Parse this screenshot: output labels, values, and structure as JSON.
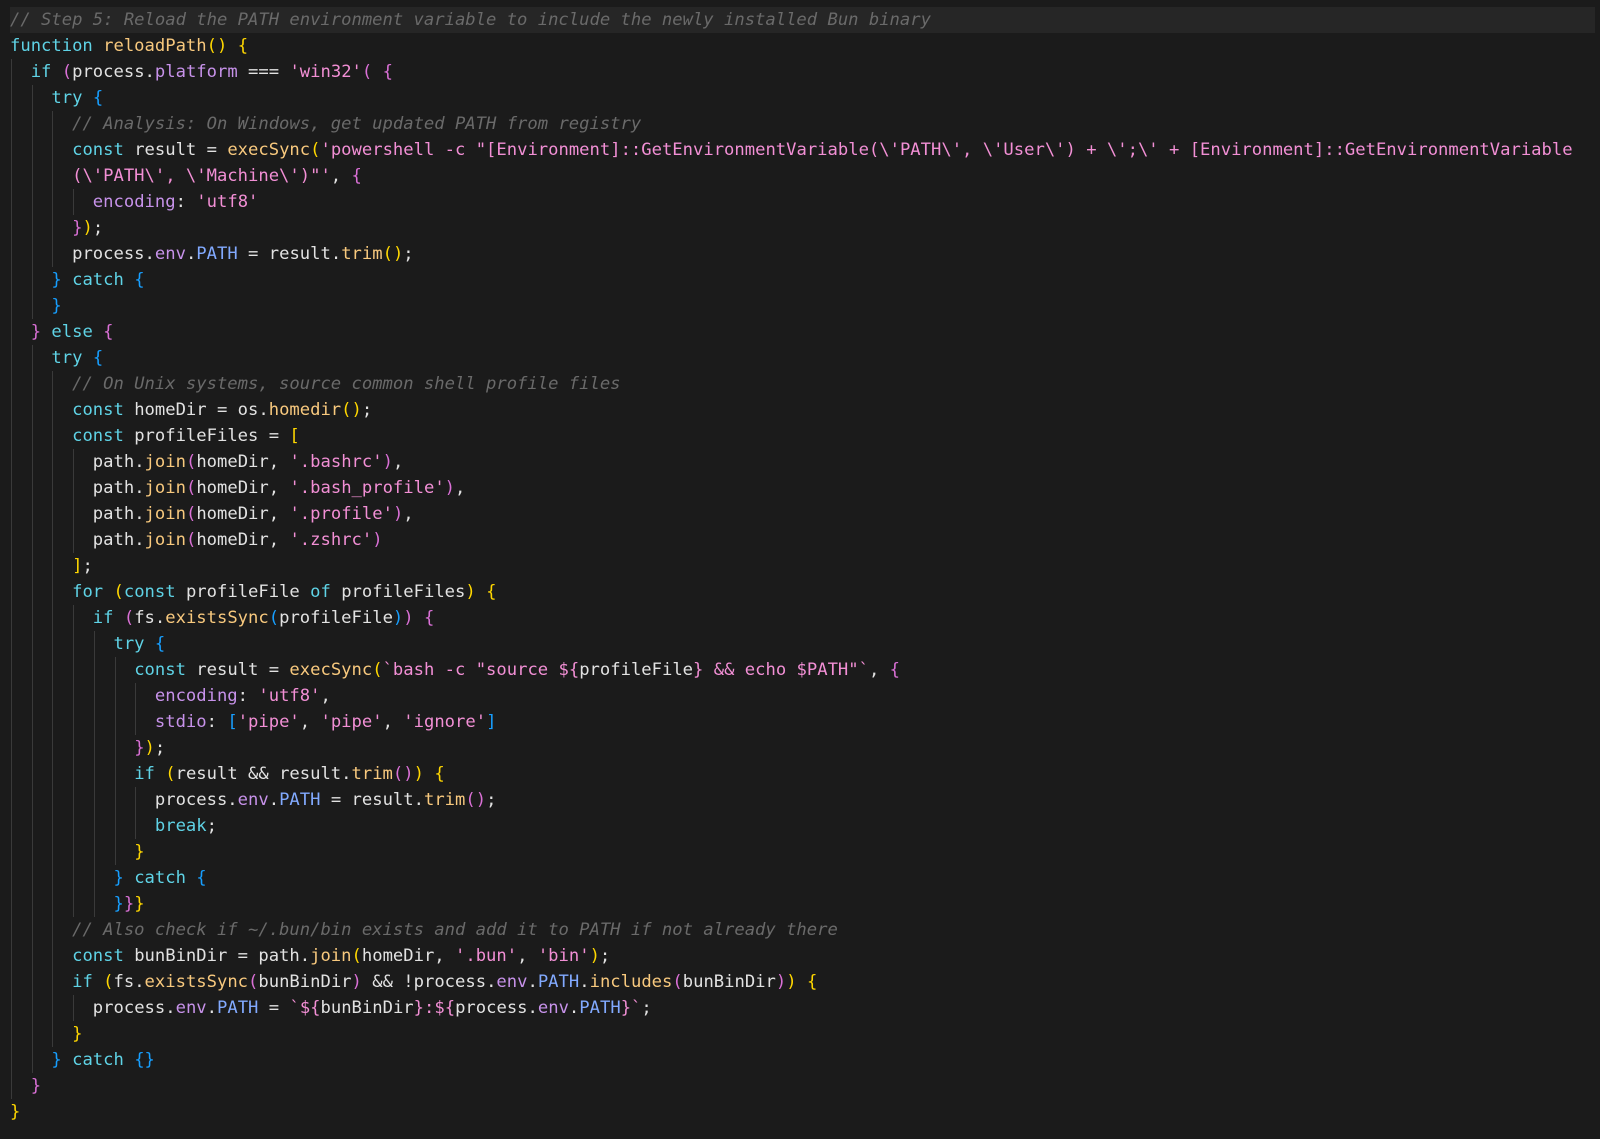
{
  "theme": {
    "background": "#1b1b1b",
    "highlight_line": "#262626",
    "indent_guide": "#3a3a3a",
    "colors": {
      "cm": "#6a6a6a",
      "kw": "#5fd3e6",
      "fn": "#f8c97e",
      "pl": "#e2e2e2",
      "pr": "#c792ea",
      "st": "#f28fd5",
      "cn": "#82aaff",
      "b1": "#ffd700",
      "b2": "#da70d6",
      "b3": "#179fff"
    }
  },
  "code": {
    "language": "javascript",
    "lines": [
      {
        "indent": 0,
        "hl": true,
        "tokens": [
          [
            "// Step 5: Reload the PATH environment variable to include the newly installed Bun binary",
            "cm"
          ]
        ]
      },
      {
        "indent": 0,
        "tokens": [
          [
            "function ",
            "kw"
          ],
          [
            "reloadPath",
            "fn"
          ],
          [
            "()",
            "b1"
          ],
          [
            " ",
            "pl"
          ],
          [
            "{",
            "b1"
          ]
        ]
      },
      {
        "indent": 1,
        "tokens": [
          [
            "if ",
            "kw"
          ],
          [
            "(",
            "b2"
          ],
          [
            "process.",
            "pl"
          ],
          [
            "platform",
            "pr"
          ],
          [
            " === ",
            "pl"
          ],
          [
            "'win32'",
            "st"
          ],
          [
            "(",
            "b2"
          ],
          [
            " ",
            "pl"
          ],
          [
            "{",
            "b2"
          ]
        ]
      },
      {
        "indent": 2,
        "tokens": [
          [
            "try ",
            "kw"
          ],
          [
            "{",
            "b3"
          ]
        ]
      },
      {
        "indent": 3,
        "tokens": [
          [
            "// Analysis: On Windows, get updated PATH from registry",
            "cm"
          ]
        ]
      },
      {
        "indent": 3,
        "tokens": [
          [
            "const ",
            "kw"
          ],
          [
            "result = ",
            "pl"
          ],
          [
            "execSync",
            "fn"
          ],
          [
            "(",
            "b1"
          ],
          [
            "'powershell -c \"[Environment]::GetEnvironmentVariable(\\'PATH\\', \\'User\\') + \\';\\' + [Environment]::GetEnvironmentVariable",
            "st"
          ]
        ]
      },
      {
        "indent": 3,
        "tokens": [
          [
            "(\\'PATH\\', \\'Machine\\')\"'",
            "st"
          ],
          [
            ", ",
            "pl"
          ],
          [
            "{",
            "b2"
          ]
        ]
      },
      {
        "indent": 4,
        "tokens": [
          [
            "encoding",
            "pr"
          ],
          [
            ": ",
            "pl"
          ],
          [
            "'utf8'",
            "st"
          ]
        ]
      },
      {
        "indent": 3,
        "tokens": [
          [
            "}",
            "b2"
          ],
          [
            ")",
            "b1"
          ],
          [
            ";",
            "pl"
          ]
        ]
      },
      {
        "indent": 3,
        "tokens": [
          [
            "process.",
            "pl"
          ],
          [
            "env",
            "pr"
          ],
          [
            ".",
            "pl"
          ],
          [
            "PATH",
            "cn"
          ],
          [
            " = result.",
            "pl"
          ],
          [
            "trim",
            "fn"
          ],
          [
            "()",
            "b1"
          ],
          [
            ";",
            "pl"
          ]
        ]
      },
      {
        "indent": 2,
        "tokens": [
          [
            "} ",
            "b3"
          ],
          [
            "catch ",
            "kw"
          ],
          [
            "{",
            "b3"
          ]
        ]
      },
      {
        "indent": 2,
        "tokens": [
          [
            "}",
            "b3"
          ]
        ]
      },
      {
        "indent": 1,
        "tokens": [
          [
            "} ",
            "b2"
          ],
          [
            "else ",
            "kw"
          ],
          [
            "{",
            "b2"
          ]
        ]
      },
      {
        "indent": 2,
        "tokens": [
          [
            "try ",
            "kw"
          ],
          [
            "{",
            "b3"
          ]
        ]
      },
      {
        "indent": 3,
        "tokens": [
          [
            "// On Unix systems, source common shell profile files",
            "cm"
          ]
        ]
      },
      {
        "indent": 3,
        "tokens": [
          [
            "const ",
            "kw"
          ],
          [
            "homeDir = os.",
            "pl"
          ],
          [
            "homedir",
            "fn"
          ],
          [
            "()",
            "b1"
          ],
          [
            ";",
            "pl"
          ]
        ]
      },
      {
        "indent": 3,
        "tokens": [
          [
            "const ",
            "kw"
          ],
          [
            "profileFiles = ",
            "pl"
          ],
          [
            "[",
            "b1"
          ]
        ]
      },
      {
        "indent": 4,
        "tokens": [
          [
            "path.",
            "pl"
          ],
          [
            "join",
            "fn"
          ],
          [
            "(",
            "b2"
          ],
          [
            "homeDir, ",
            "pl"
          ],
          [
            "'.bashrc'",
            "st"
          ],
          [
            ")",
            "b2"
          ],
          [
            ",",
            "pl"
          ]
        ]
      },
      {
        "indent": 4,
        "tokens": [
          [
            "path.",
            "pl"
          ],
          [
            "join",
            "fn"
          ],
          [
            "(",
            "b2"
          ],
          [
            "homeDir, ",
            "pl"
          ],
          [
            "'.bash_profile'",
            "st"
          ],
          [
            ")",
            "b2"
          ],
          [
            ",",
            "pl"
          ]
        ]
      },
      {
        "indent": 4,
        "tokens": [
          [
            "path.",
            "pl"
          ],
          [
            "join",
            "fn"
          ],
          [
            "(",
            "b2"
          ],
          [
            "homeDir, ",
            "pl"
          ],
          [
            "'.profile'",
            "st"
          ],
          [
            ")",
            "b2"
          ],
          [
            ",",
            "pl"
          ]
        ]
      },
      {
        "indent": 4,
        "tokens": [
          [
            "path.",
            "pl"
          ],
          [
            "join",
            "fn"
          ],
          [
            "(",
            "b2"
          ],
          [
            "homeDir, ",
            "pl"
          ],
          [
            "'.zshrc'",
            "st"
          ],
          [
            ")",
            "b2"
          ]
        ]
      },
      {
        "indent": 3,
        "tokens": [
          [
            "]",
            "b1"
          ],
          [
            ";",
            "pl"
          ]
        ]
      },
      {
        "indent": 3,
        "tokens": [
          [
            "for ",
            "kw"
          ],
          [
            "(",
            "b1"
          ],
          [
            "const ",
            "kw"
          ],
          [
            "profileFile ",
            "pl"
          ],
          [
            "of ",
            "kw"
          ],
          [
            "profileFiles",
            "pl"
          ],
          [
            ")",
            "b1"
          ],
          [
            " ",
            "pl"
          ],
          [
            "{",
            "b1"
          ]
        ]
      },
      {
        "indent": 4,
        "tokens": [
          [
            "if ",
            "kw"
          ],
          [
            "(",
            "b2"
          ],
          [
            "fs.",
            "pl"
          ],
          [
            "existsSync",
            "fn"
          ],
          [
            "(",
            "b3"
          ],
          [
            "profileFile",
            "pl"
          ],
          [
            ")",
            "b3"
          ],
          [
            ")",
            "b2"
          ],
          [
            " ",
            "pl"
          ],
          [
            "{",
            "b2"
          ]
        ]
      },
      {
        "indent": 5,
        "tokens": [
          [
            "try ",
            "kw"
          ],
          [
            "{",
            "b3"
          ]
        ]
      },
      {
        "indent": 6,
        "tokens": [
          [
            "const ",
            "kw"
          ],
          [
            "result = ",
            "pl"
          ],
          [
            "execSync",
            "fn"
          ],
          [
            "(",
            "b1"
          ],
          [
            "`bash -c \"source ",
            "st"
          ],
          [
            "${",
            "st"
          ],
          [
            "profileFile",
            "pl"
          ],
          [
            "}",
            "st"
          ],
          [
            " && echo $PATH\"`",
            "st"
          ],
          [
            ", ",
            "pl"
          ],
          [
            "{",
            "b2"
          ]
        ]
      },
      {
        "indent": 7,
        "tokens": [
          [
            "encoding",
            "pr"
          ],
          [
            ": ",
            "pl"
          ],
          [
            "'utf8'",
            "st"
          ],
          [
            ",",
            "pl"
          ]
        ]
      },
      {
        "indent": 7,
        "tokens": [
          [
            "stdio",
            "pr"
          ],
          [
            ": ",
            "pl"
          ],
          [
            "[",
            "b3"
          ],
          [
            "'pipe'",
            "st"
          ],
          [
            ", ",
            "pl"
          ],
          [
            "'pipe'",
            "st"
          ],
          [
            ", ",
            "pl"
          ],
          [
            "'ignore'",
            "st"
          ],
          [
            "]",
            "b3"
          ]
        ]
      },
      {
        "indent": 6,
        "tokens": [
          [
            "}",
            "b2"
          ],
          [
            ")",
            "b1"
          ],
          [
            ";",
            "pl"
          ]
        ]
      },
      {
        "indent": 6,
        "tokens": [
          [
            "if ",
            "kw"
          ],
          [
            "(",
            "b1"
          ],
          [
            "result && result.",
            "pl"
          ],
          [
            "trim",
            "fn"
          ],
          [
            "()",
            "b2"
          ],
          [
            ")",
            "b1"
          ],
          [
            " ",
            "pl"
          ],
          [
            "{",
            "b1"
          ]
        ]
      },
      {
        "indent": 7,
        "tokens": [
          [
            "process.",
            "pl"
          ],
          [
            "env",
            "pr"
          ],
          [
            ".",
            "pl"
          ],
          [
            "PATH",
            "cn"
          ],
          [
            " = result.",
            "pl"
          ],
          [
            "trim",
            "fn"
          ],
          [
            "()",
            "b2"
          ],
          [
            ";",
            "pl"
          ]
        ]
      },
      {
        "indent": 7,
        "tokens": [
          [
            "break",
            "kw"
          ],
          [
            ";",
            "pl"
          ]
        ]
      },
      {
        "indent": 6,
        "tokens": [
          [
            "}",
            "b1"
          ]
        ]
      },
      {
        "indent": 5,
        "tokens": [
          [
            "} ",
            "b3"
          ],
          [
            "catch ",
            "kw"
          ],
          [
            "{",
            "b3"
          ]
        ]
      },
      {
        "indent": 5,
        "tokens": [
          [
            "}",
            "b3"
          ],
          [
            "}",
            "b2"
          ],
          [
            "}",
            "b1"
          ]
        ]
      },
      {
        "indent": 3,
        "tokens": [
          [
            "// Also check if ~/.bun/bin exists and add it to PATH if not already there",
            "cm"
          ]
        ]
      },
      {
        "indent": 3,
        "tokens": [
          [
            "const ",
            "kw"
          ],
          [
            "bunBinDir = path.",
            "pl"
          ],
          [
            "join",
            "fn"
          ],
          [
            "(",
            "b1"
          ],
          [
            "homeDir, ",
            "pl"
          ],
          [
            "'.bun'",
            "st"
          ],
          [
            ", ",
            "pl"
          ],
          [
            "'bin'",
            "st"
          ],
          [
            ")",
            "b1"
          ],
          [
            ";",
            "pl"
          ]
        ]
      },
      {
        "indent": 3,
        "tokens": [
          [
            "if ",
            "kw"
          ],
          [
            "(",
            "b1"
          ],
          [
            "fs.",
            "pl"
          ],
          [
            "existsSync",
            "fn"
          ],
          [
            "(",
            "b2"
          ],
          [
            "bunBinDir",
            "pl"
          ],
          [
            ")",
            "b2"
          ],
          [
            " && !process.",
            "pl"
          ],
          [
            "env",
            "pr"
          ],
          [
            ".",
            "pl"
          ],
          [
            "PATH",
            "cn"
          ],
          [
            ".",
            "pl"
          ],
          [
            "includes",
            "fn"
          ],
          [
            "(",
            "b2"
          ],
          [
            "bunBinDir",
            "pl"
          ],
          [
            ")",
            "b2"
          ],
          [
            ")",
            "b1"
          ],
          [
            " ",
            "pl"
          ],
          [
            "{",
            "b1"
          ]
        ]
      },
      {
        "indent": 4,
        "tokens": [
          [
            "process.",
            "pl"
          ],
          [
            "env",
            "pr"
          ],
          [
            ".",
            "pl"
          ],
          [
            "PATH",
            "cn"
          ],
          [
            " = ",
            "pl"
          ],
          [
            "`",
            "st"
          ],
          [
            "${",
            "st"
          ],
          [
            "bunBinDir",
            "pl"
          ],
          [
            "}",
            "st"
          ],
          [
            ":",
            "st"
          ],
          [
            "${",
            "st"
          ],
          [
            "process.",
            "pl"
          ],
          [
            "env",
            "pr"
          ],
          [
            ".",
            "pl"
          ],
          [
            "PATH",
            "cn"
          ],
          [
            "}",
            "st"
          ],
          [
            "`",
            "st"
          ],
          [
            ";",
            "pl"
          ]
        ]
      },
      {
        "indent": 3,
        "tokens": [
          [
            "}",
            "b1"
          ]
        ]
      },
      {
        "indent": 2,
        "tokens": [
          [
            "} ",
            "b3"
          ],
          [
            "catch ",
            "kw"
          ],
          [
            "{}",
            "b3"
          ]
        ]
      },
      {
        "indent": 1,
        "tokens": [
          [
            "}",
            "b2"
          ]
        ]
      },
      {
        "indent": 0,
        "tokens": [
          [
            "}",
            "b1"
          ]
        ]
      }
    ]
  }
}
